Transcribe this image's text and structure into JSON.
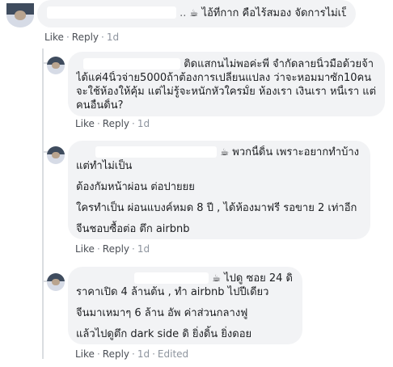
{
  "comments": [
    {
      "text_lines": [
        "ไอ้ที่กาก คือไร้สมอง จัดการไม่เป็น"
      ],
      "actions": {
        "like": "Like",
        "reply": "Reply",
        "time": "1d"
      }
    },
    {
      "text_lines": [
        "ติดแสกนไม่พอค่ะพี่ จำกัดลายนิ้วมือด้วยจ้า",
        "ได้แค่4นิ้วจ่าย5000ถ้าต้องการเปลี่ยนแปลง ว่าจะหอมมาซัก10คน",
        "จะใช้ห้องให้คุ้ม แต่ไม่รู้จะหนักหัวใครมั้ย ห้องเรา เงินเรา หนี้เรา แต่",
        "คนอื่นดิ้น?"
      ],
      "actions": {
        "like": "Like",
        "reply": "Reply",
        "time": "1d"
      }
    },
    {
      "first_line": "พวกนี้ดิ้น เพราะอยากทำบ้าง",
      "paragraphs": [
        "แต่ทำไม่เป็น",
        "ต้องกัมหน้าผ่อน ต่อปายยย",
        "ใครทำเป็น ผ่อนแบงค์หมด 8 ปี , ได้ห้องมาฟรี รอขาย 2 เท่าอีก",
        "จีนชอบซื้อต่อ ตึก airbnb"
      ],
      "actions": {
        "like": "Like",
        "reply": "Reply",
        "time": "1d"
      }
    },
    {
      "first_line": "ไปดู ซอย 24 ดิ",
      "paragraphs": [
        "ราคาเปิด 4 ล้านต้น , ทำ airbnb ไปปีเดียว",
        "จีนมาเหมาๆ 6 ล้าน อัพ ค่าส่วนกลางฟู",
        "แล้วไปดูตึก dark side ดิ ยิ่งดิ้น ยิ่งดอย"
      ],
      "actions": {
        "like": "Like",
        "reply": "Reply",
        "time": "1d",
        "edited": "Edited"
      }
    }
  ],
  "icons": {
    "cup": "☕",
    "dot": "·"
  },
  "colors": {
    "bubble": "#f2f3f5",
    "action_text": "#4b4f56",
    "meta_text": "#8d949e",
    "thread_line": "#dadde1"
  }
}
